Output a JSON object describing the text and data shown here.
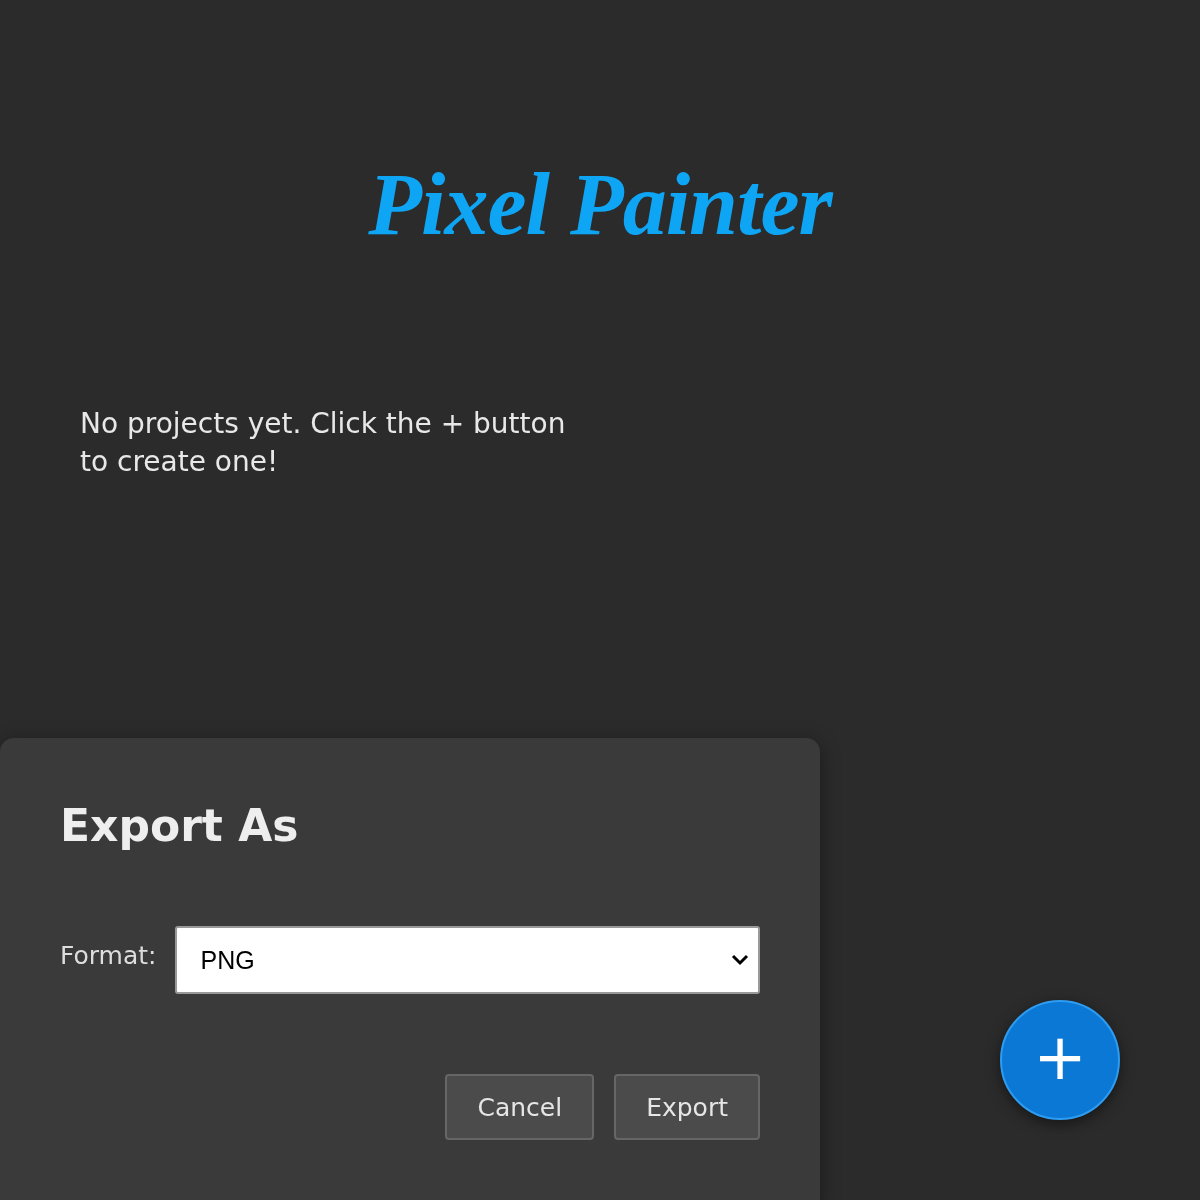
{
  "app_title": "Pixel Painter",
  "empty_message": "No projects yet. Click the + button to create one!",
  "dialog": {
    "title": "Export As",
    "format_label": "Format:",
    "format_value": "PNG",
    "buttons": [
      "Cancel",
      "Export"
    ]
  },
  "fab": {
    "label": "+"
  }
}
